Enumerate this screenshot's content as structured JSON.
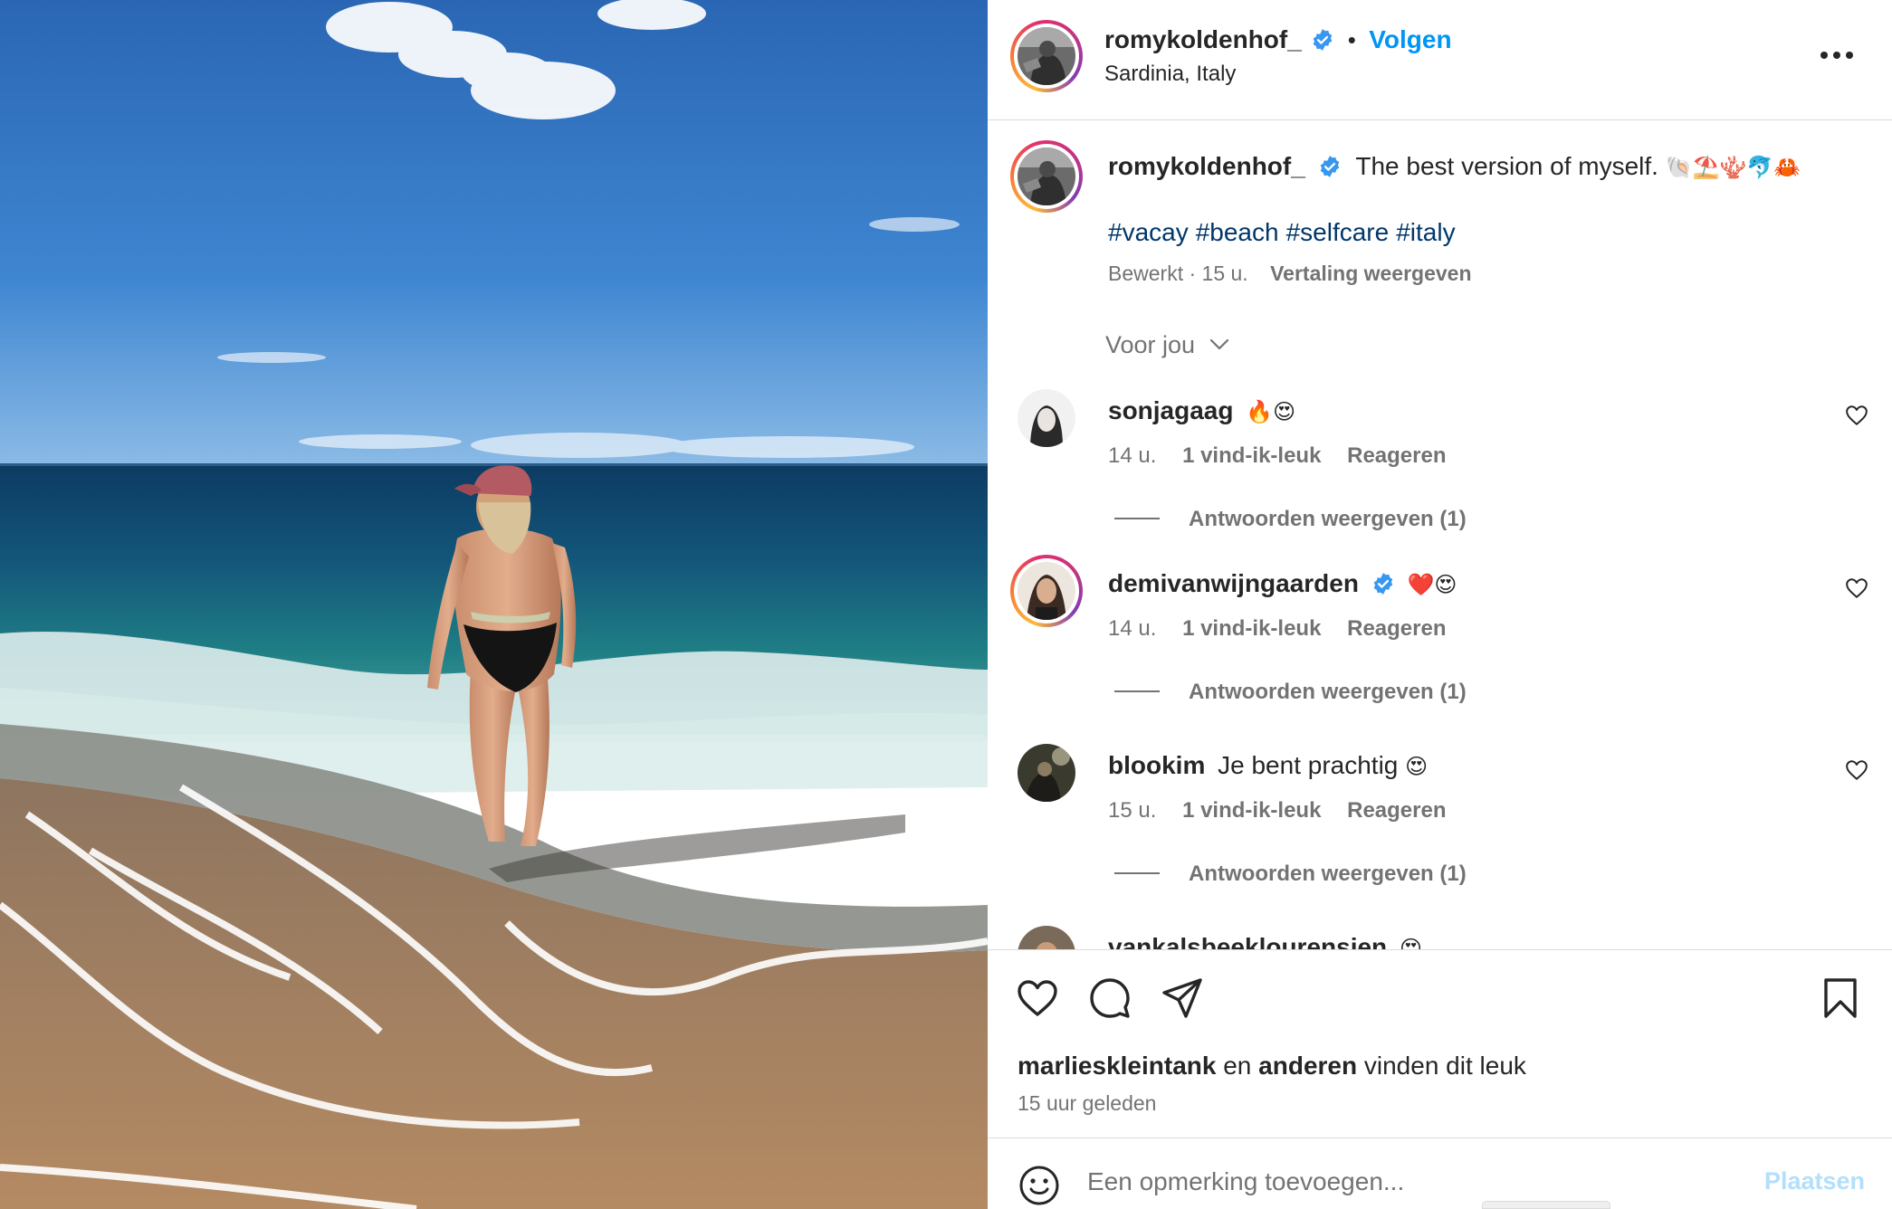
{
  "post": {
    "author": "romykoldenhof_",
    "follow_label": "Volgen",
    "separator": "•",
    "location": "Sardinia, Italy",
    "more_icon": "more-horizontal-icon"
  },
  "caption": {
    "author": "romykoldenhof_",
    "text": "The best version of myself.",
    "emojis": "🐚⛱️🪸🐬🦀",
    "hashtags": [
      "#vacay",
      "#beach",
      "#selfcare",
      "#italy"
    ],
    "edited_label": "Bewerkt",
    "time": "15 u.",
    "translate_label": "Vertaling weergeven"
  },
  "sort": {
    "label": "Voor jou"
  },
  "comments": [
    {
      "user": "sonjagaag",
      "verified": false,
      "text": "",
      "emojis": "🔥😍",
      "time": "14 u.",
      "likes": "1 vind-ik-leuk",
      "reply": "Reageren",
      "view_replies": "Antwoorden weergeven (1)"
    },
    {
      "user": "demivanwijngaarden",
      "verified": true,
      "text": "",
      "emojis": "❤️😍",
      "time": "14 u.",
      "likes": "1 vind-ik-leuk",
      "reply": "Reageren",
      "view_replies": "Antwoorden weergeven (1)"
    },
    {
      "user": "blookim",
      "verified": false,
      "text": "Je bent prachtig",
      "emojis": "😍",
      "time": "15 u.",
      "likes": "1 vind-ik-leuk",
      "reply": "Reageren",
      "view_replies": "Antwoorden weergeven (1)"
    },
    {
      "user": "vankalsbeeklourensien",
      "verified": false,
      "text": "",
      "emojis": "😍"
    }
  ],
  "likes": {
    "user": "marlieskleintank",
    "and": "en",
    "others": "anderen",
    "suffix": "vinden dit leuk"
  },
  "timeago": "15 uur geleden",
  "composer": {
    "placeholder": "Een opmerking toevoegen...",
    "post_label": "Plaatsen"
  },
  "colors": {
    "link_blue": "#0095f6",
    "hashtag_blue": "#00376b",
    "secondary_text": "#737373",
    "verified_blue": "#3897f0",
    "post_disabled": "#b2dffc"
  }
}
